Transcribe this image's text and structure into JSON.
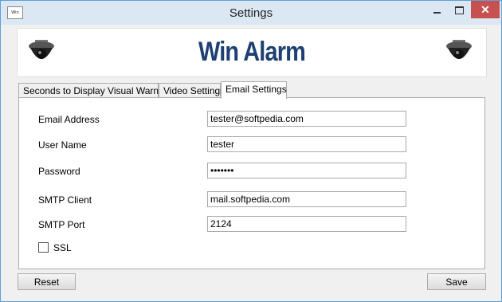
{
  "window": {
    "title": "Settings",
    "app_icon_text": "Win Alarm",
    "minimize_label": "—",
    "close_label": "✕"
  },
  "banner": {
    "title": "Win Alarm"
  },
  "tabs": [
    {
      "label": "Seconds to Display Visual Warning"
    },
    {
      "label": "Video Settings"
    },
    {
      "label": "Email Settings"
    }
  ],
  "email_settings": {
    "email_address": {
      "label": "Email Address",
      "value": "tester@softpedia.com"
    },
    "user_name": {
      "label": "User Name",
      "value": "tester"
    },
    "password": {
      "label": "Password",
      "value": "•••••••"
    },
    "smtp_client": {
      "label": "SMTP Client",
      "value": "mail.softpedia.com"
    },
    "smtp_port": {
      "label": "SMTP Port",
      "value": "2124"
    },
    "ssl": {
      "label": "SSL",
      "checked": false
    }
  },
  "buttons": {
    "reset": "Reset",
    "save": "Save"
  },
  "colors": {
    "title_bar": "#dbe7f3",
    "close_button": "#c75050",
    "banner_text": "#1d3f72"
  }
}
